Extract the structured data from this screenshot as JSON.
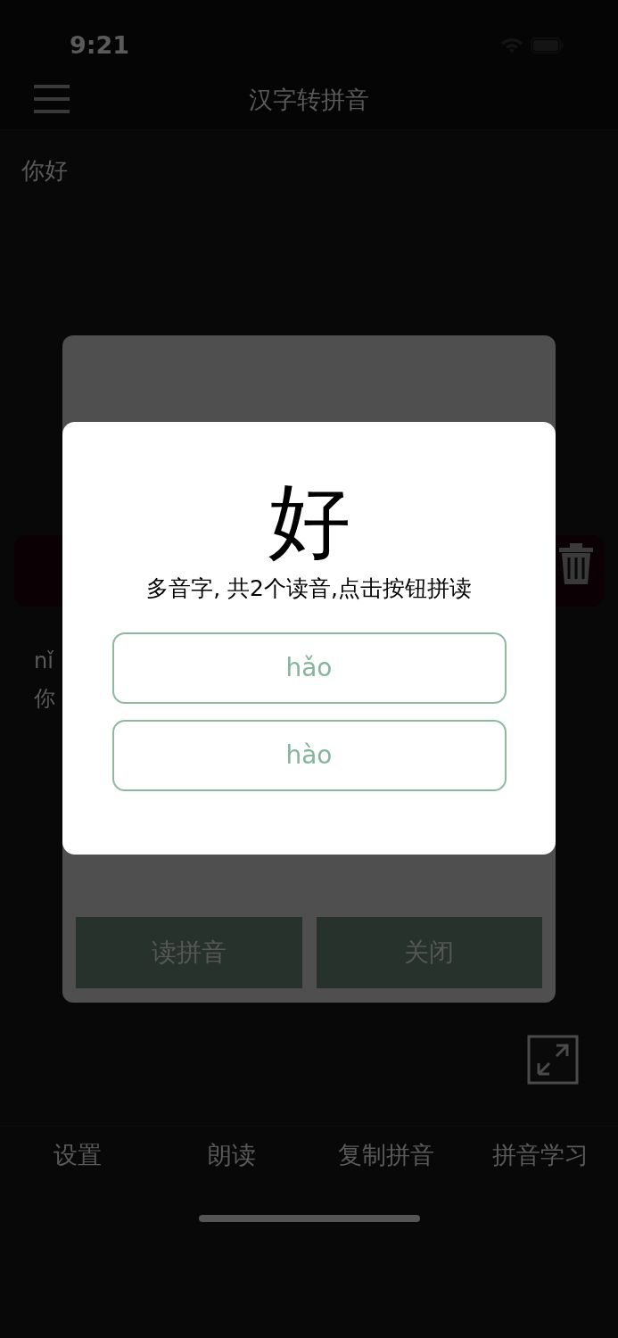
{
  "status_bar": {
    "time": "9:21"
  },
  "nav_bar": {
    "title": "汉字转拼音"
  },
  "input": {
    "text": "你好"
  },
  "result": {
    "pinyin": "nǐ",
    "hanzi": "你"
  },
  "dialog": {
    "buttons": [
      "读拼音",
      "关闭"
    ]
  },
  "popup": {
    "character": "好",
    "message": "多音字, 共2个读音,点击按钮拼读",
    "readings": [
      "hǎo",
      "hào"
    ]
  },
  "tab_bar": [
    {
      "label": "设置"
    },
    {
      "label": "朗读"
    },
    {
      "label": "复制拼音"
    },
    {
      "label": "拼音学习"
    }
  ]
}
